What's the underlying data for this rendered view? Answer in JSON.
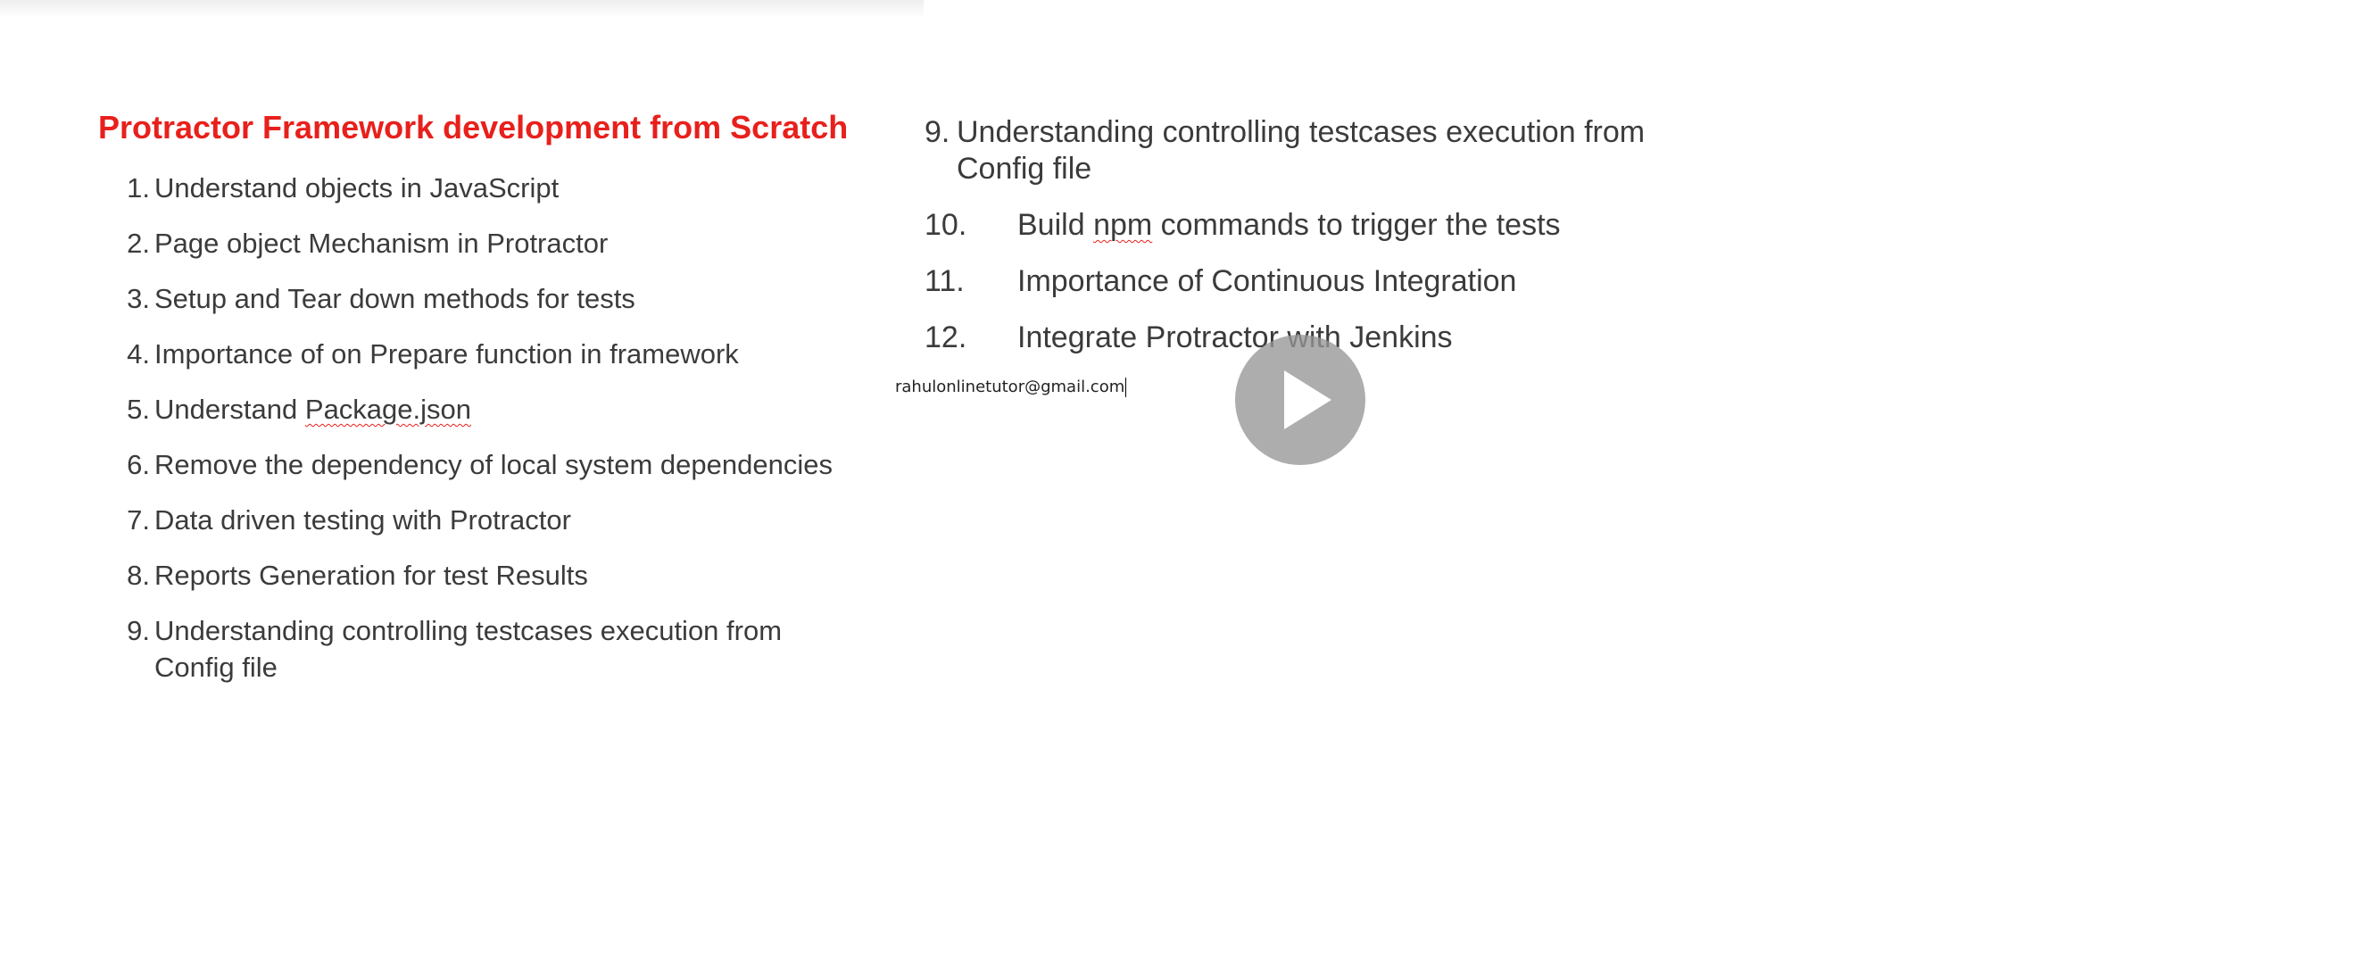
{
  "slide": {
    "title": "Protractor Framework development from Scratch",
    "left_items": [
      {
        "num": "1.",
        "parts": [
          {
            "text": "Understand objects in JavaScript",
            "squiggle": false
          }
        ]
      },
      {
        "num": "2.",
        "parts": [
          {
            "text": "Page object Mechanism in Protractor",
            "squiggle": false
          }
        ]
      },
      {
        "num": "3.",
        "parts": [
          {
            "text": "Setup and Tear down methods for tests",
            "squiggle": false
          }
        ]
      },
      {
        "num": "4.",
        "parts": [
          {
            "text": "Importance of on Prepare function in framework",
            "squiggle": false
          }
        ]
      },
      {
        "num": "5.",
        "parts": [
          {
            "text": "Understand ",
            "squiggle": false
          },
          {
            "text": "Package.json",
            "squiggle": true
          }
        ]
      },
      {
        "num": "6.",
        "parts": [
          {
            "text": "Remove the dependency of local system dependencies",
            "squiggle": false
          }
        ]
      },
      {
        "num": "7.",
        "parts": [
          {
            "text": "Data driven testing with Protractor",
            "squiggle": false
          }
        ]
      },
      {
        "num": "8.",
        "parts": [
          {
            "text": "Reports Generation for test Results",
            "squiggle": false
          }
        ]
      },
      {
        "num": "9.",
        "parts": [
          {
            "text": "Understanding controlling testcases execution from Config file",
            "squiggle": false
          }
        ]
      }
    ],
    "right_items": [
      {
        "num": "9.",
        "wide": false,
        "parts": [
          {
            "text": "Understanding controlling testcases execution from Config file",
            "squiggle": false
          }
        ]
      },
      {
        "num": "10.",
        "wide": true,
        "parts": [
          {
            "text": "Build ",
            "squiggle": false
          },
          {
            "text": "npm",
            "squiggle": true
          },
          {
            "text": " commands to trigger the tests",
            "squiggle": false
          }
        ]
      },
      {
        "num": "11.",
        "wide": true,
        "parts": [
          {
            "text": "Importance of Continuous Integration",
            "squiggle": false
          }
        ]
      },
      {
        "num": "12.",
        "wide": true,
        "parts": [
          {
            "text": "Integrate Protractor with Jenkins",
            "squiggle": false
          }
        ]
      }
    ],
    "email": "rahulonlinetutor@gmail.com"
  },
  "player": {
    "play_icon": "play-icon",
    "overlay_color": "#969696"
  }
}
